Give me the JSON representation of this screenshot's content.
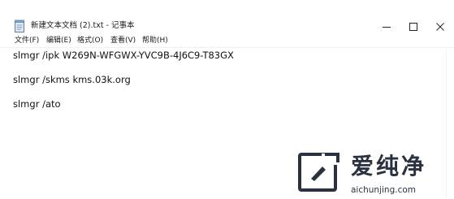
{
  "window": {
    "title": "新建文本文档 (2).txt - 记事本",
    "icon": "notepad-icon",
    "controls": {
      "minimize": "minimize-icon",
      "maximize": "maximize-icon",
      "close": "close-icon"
    }
  },
  "menu": [
    {
      "label": "文件(F)"
    },
    {
      "label": "编辑(E)"
    },
    {
      "label": "格式(O)"
    },
    {
      "label": "查看(V)"
    },
    {
      "label": "帮助(H)"
    }
  ],
  "content": {
    "lines": [
      "slmgr /ipk W269N-WFGWX-YVC9B-4J6C9-T83GX",
      "slmgr /skms kms.03k.org",
      "slmgr /ato"
    ]
  },
  "watermark": {
    "brand": "爱纯净",
    "url": "aichunjing.com",
    "color": "#2a3240"
  }
}
